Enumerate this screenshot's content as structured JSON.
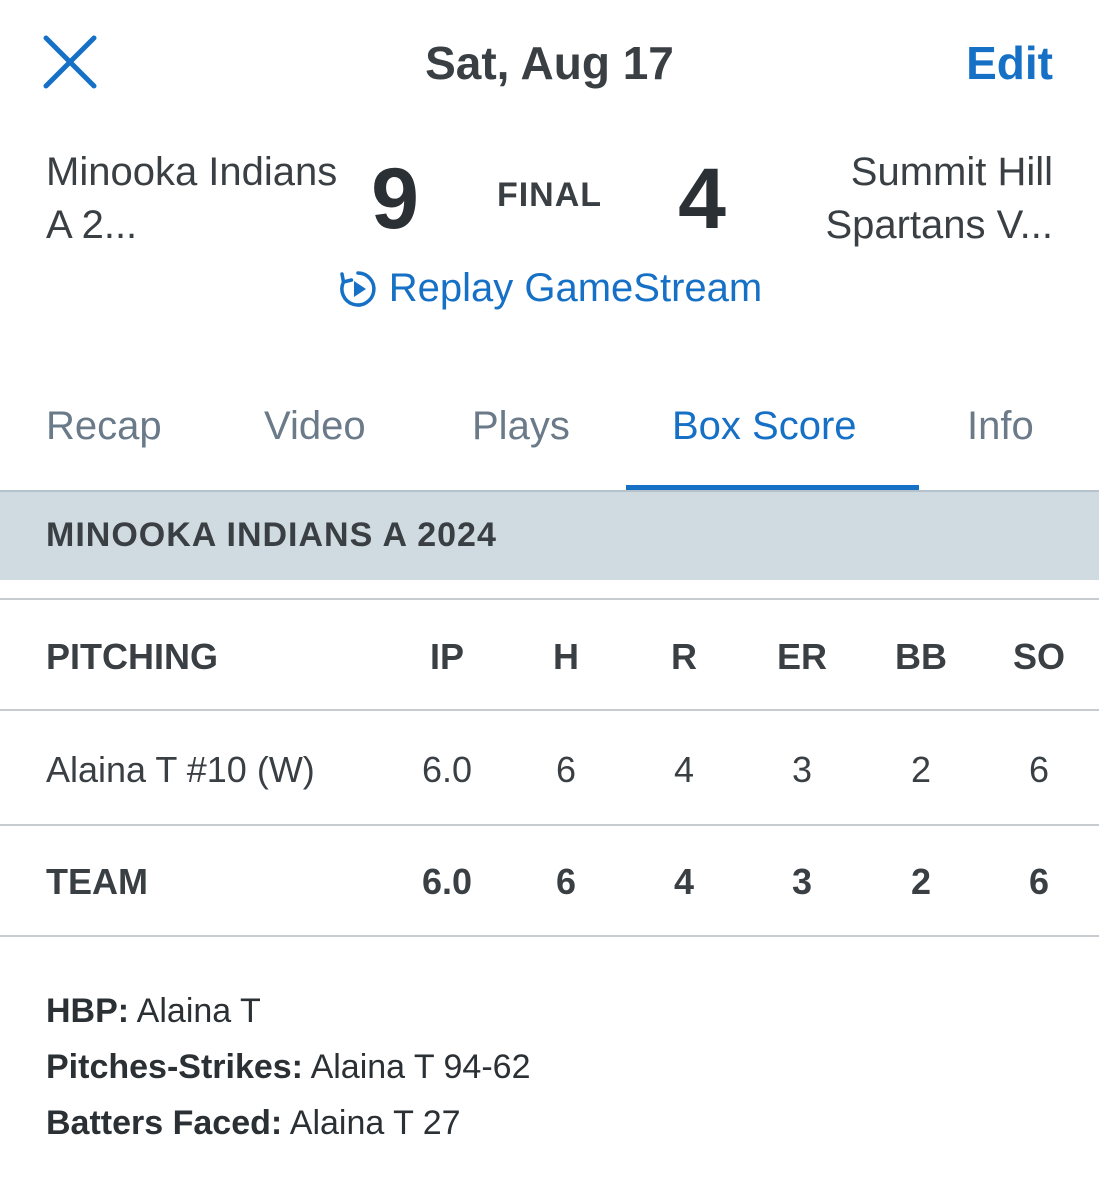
{
  "header": {
    "date": "Sat, Aug 17",
    "edit_label": "Edit"
  },
  "game": {
    "home_team": "Minooka Indians A 2...",
    "away_team": "Summit Hill Spartans V...",
    "home_score": "9",
    "away_score": "4",
    "status": "FINAL",
    "replay_label": "Replay GameStream"
  },
  "tabs": [
    {
      "label": "Recap"
    },
    {
      "label": "Video"
    },
    {
      "label": "Plays"
    },
    {
      "label": "Box Score"
    },
    {
      "label": "Info"
    }
  ],
  "section_title": "MINOOKA INDIANS A 2024",
  "pitching": {
    "columns": [
      "PITCHING",
      "IP",
      "H",
      "R",
      "ER",
      "BB",
      "SO"
    ],
    "players": [
      {
        "name": "Alaina T #10 (W)",
        "ip": "6.0",
        "h": "6",
        "r": "4",
        "er": "3",
        "bb": "2",
        "so": "6"
      }
    ],
    "team": {
      "name": "TEAM",
      "ip": "6.0",
      "h": "6",
      "r": "4",
      "er": "3",
      "bb": "2",
      "so": "6"
    }
  },
  "notes": [
    {
      "label": "HBP:",
      "value": " Alaina T"
    },
    {
      "label": "Pitches-Strikes:",
      "value": " Alaina T 94-62"
    },
    {
      "label": "Batters Faced:",
      "value": " Alaina T 27"
    }
  ],
  "colors": {
    "accent": "#1570c6",
    "section_bg": "#cfdae1",
    "tab_inactive": "#6a7a89"
  }
}
